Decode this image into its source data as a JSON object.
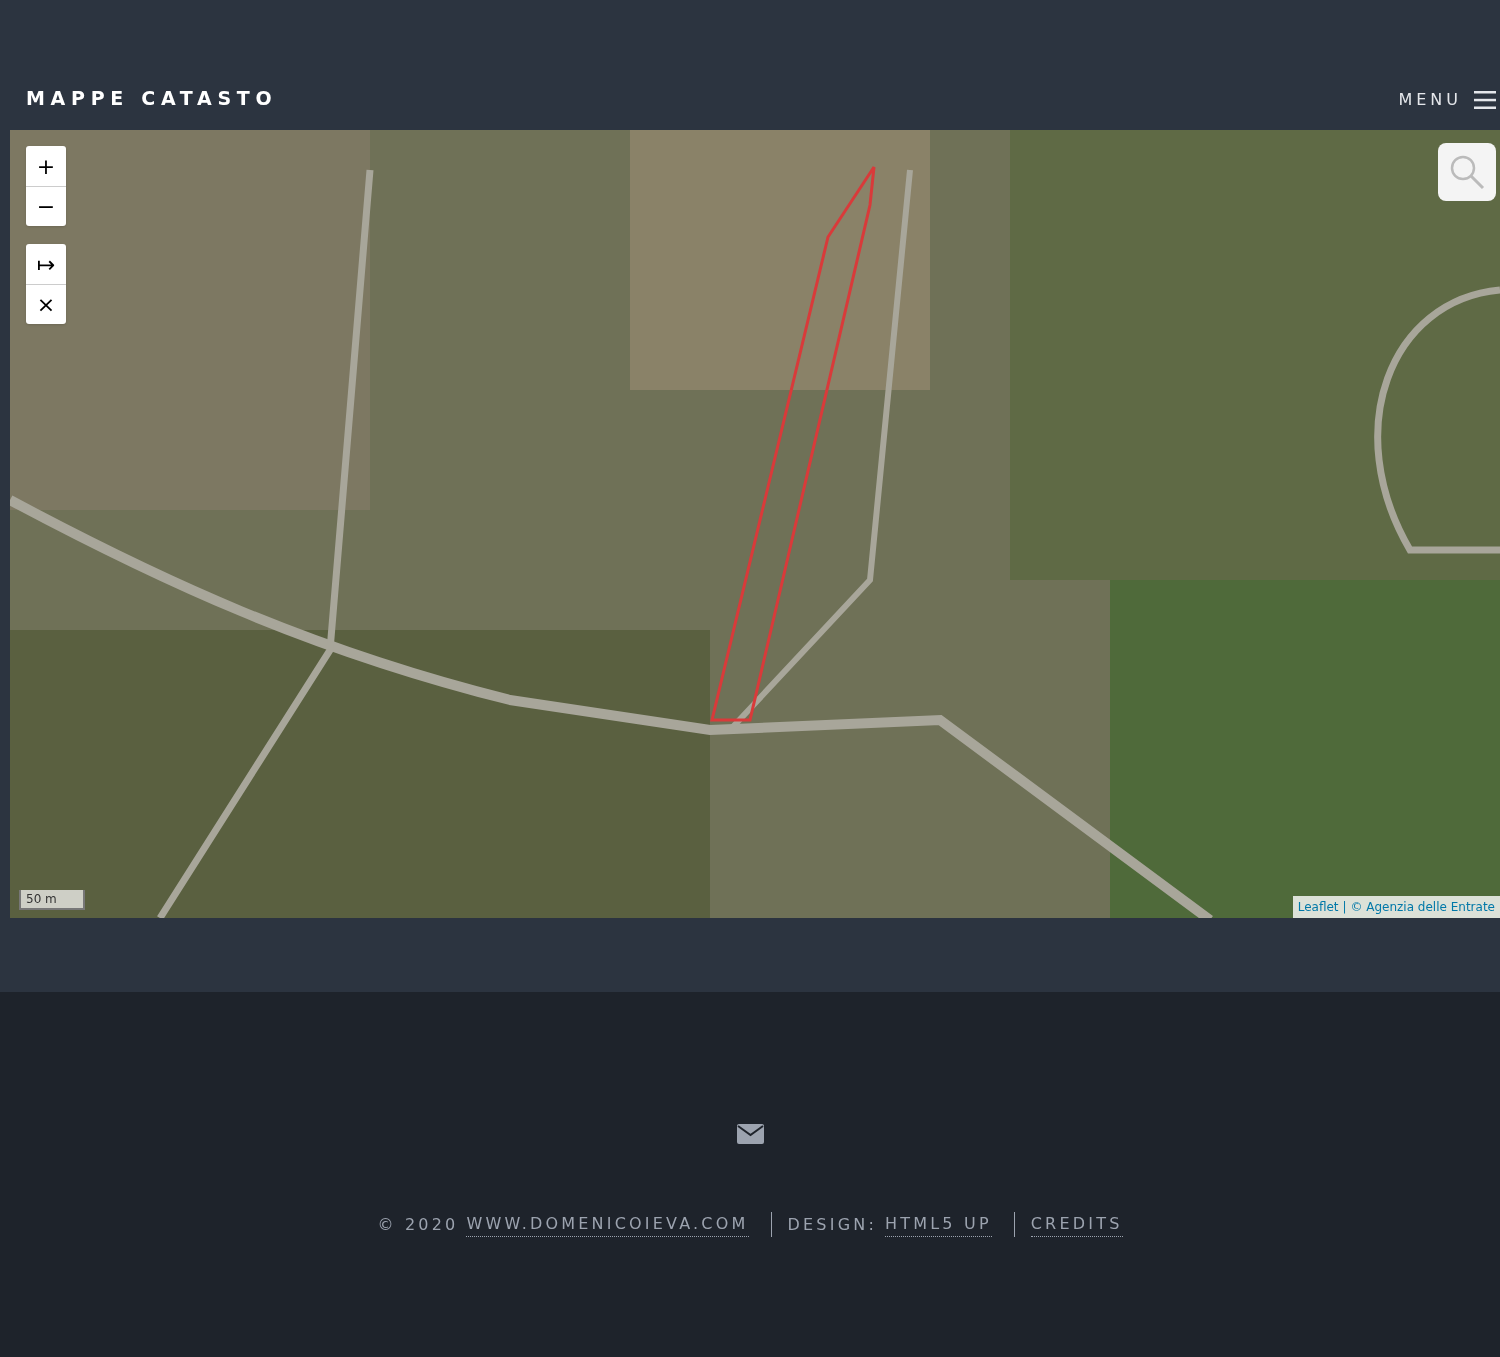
{
  "header": {
    "title": "MAPPE CATASTO",
    "menu_label": "MENU"
  },
  "map": {
    "zoom_controls": [
      "+",
      "−"
    ],
    "draw_controls": [
      "↦",
      "×"
    ],
    "scale": "50 m",
    "attribution_link": "Leaflet",
    "attribution_text": "| © Agenzia delle Entrate"
  },
  "footer": {
    "items": [
      {
        "prefix": "© 2020",
        "link": "WWW.DOMENICOIEVA.COM"
      },
      {
        "prefix": "DESIGN:",
        "link": "HTML5 UP"
      },
      {
        "link": "CREDITS"
      }
    ]
  }
}
